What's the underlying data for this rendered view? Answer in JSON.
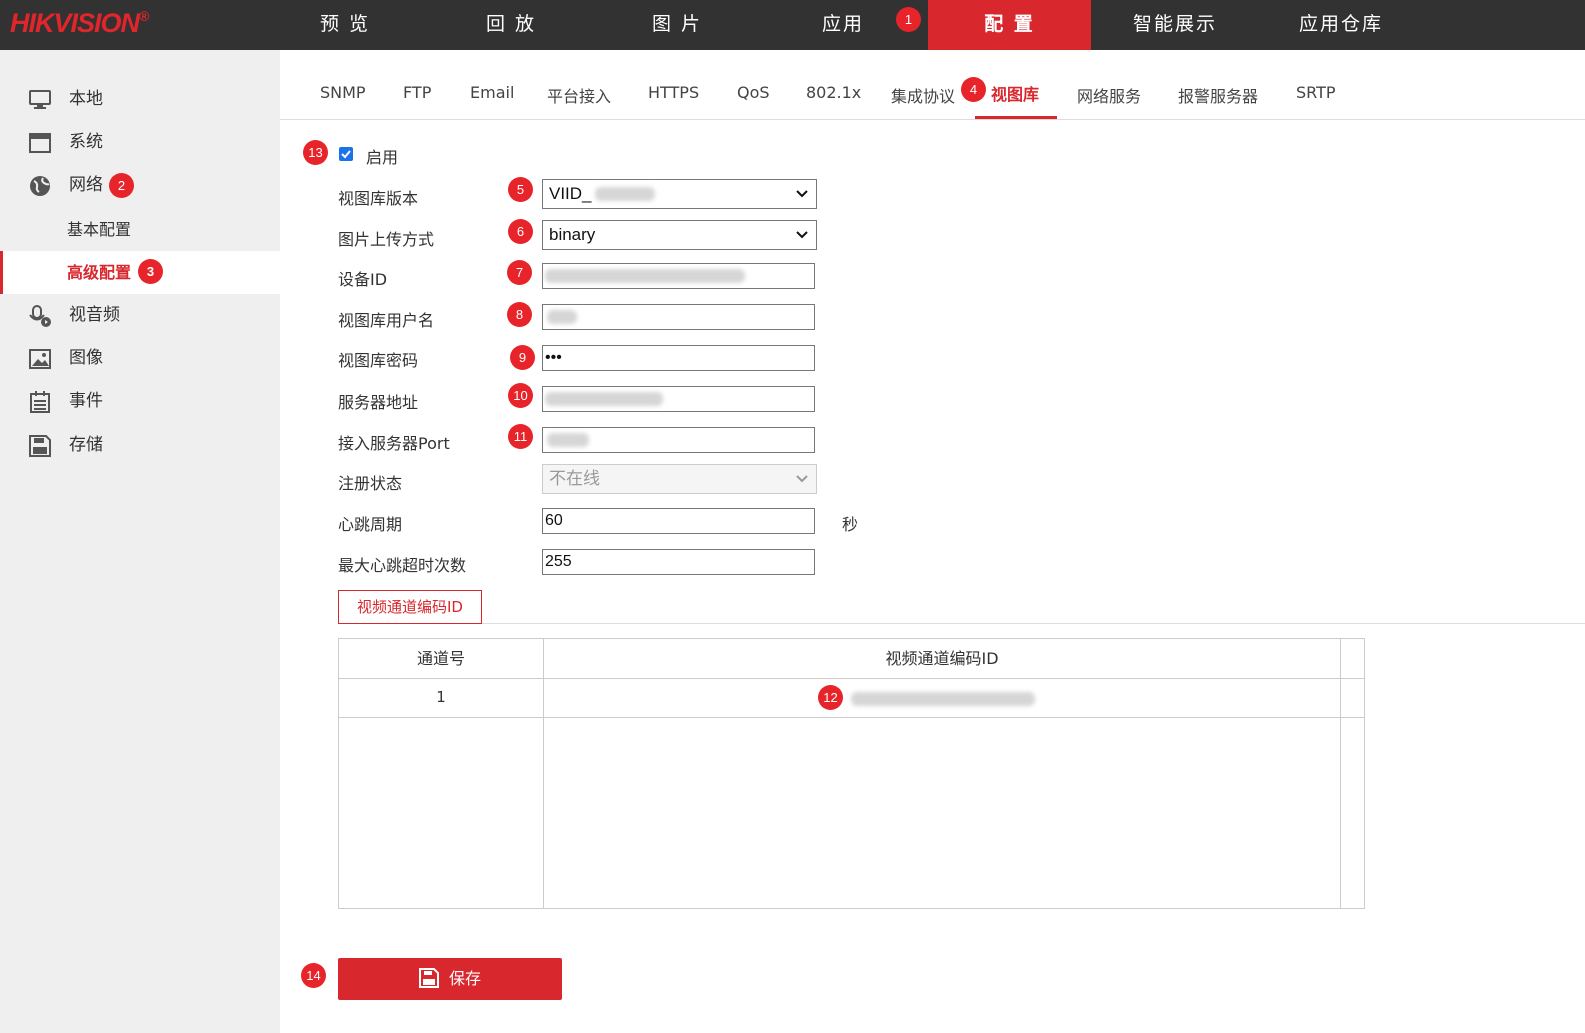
{
  "brand": {
    "name_part1": "HIK",
    "name_part2": "VISION",
    "reg": "®"
  },
  "topnav": [
    {
      "label": "预 览"
    },
    {
      "label": "回 放"
    },
    {
      "label": "图 片"
    },
    {
      "label": "应用"
    },
    {
      "label": "配 置",
      "active": true
    },
    {
      "label": "智能展示"
    },
    {
      "label": "应用仓库"
    }
  ],
  "sidebar": {
    "items": [
      {
        "label": "本地",
        "icon": "monitor-icon"
      },
      {
        "label": "系统",
        "icon": "window-icon"
      },
      {
        "label": "网络",
        "icon": "globe-icon"
      },
      {
        "label": "视音频",
        "icon": "microphone-icon"
      },
      {
        "label": "图像",
        "icon": "image-icon"
      },
      {
        "label": "事件",
        "icon": "calendar-icon"
      },
      {
        "label": "存储",
        "icon": "save-disk-icon"
      }
    ],
    "network_sub": [
      {
        "label": "基本配置"
      },
      {
        "label": "高级配置",
        "active": true
      }
    ]
  },
  "subtabs": [
    {
      "label": "SNMP"
    },
    {
      "label": "FTP"
    },
    {
      "label": "Email"
    },
    {
      "label": "平台接入"
    },
    {
      "label": "HTTPS"
    },
    {
      "label": "QoS"
    },
    {
      "label": "802.1x"
    },
    {
      "label": "集成协议"
    },
    {
      "label": "视图库",
      "active": true
    },
    {
      "label": "网络服务"
    },
    {
      "label": "报警服务器"
    },
    {
      "label": "SRTP"
    }
  ],
  "badges": [
    "1",
    "2",
    "3",
    "4",
    "5",
    "6",
    "7",
    "8",
    "9",
    "10",
    "11",
    "12",
    "13",
    "14"
  ],
  "form": {
    "enable_label": "启用",
    "enable_checked": true,
    "version_label": "视图库版本",
    "version_value": "VIID_",
    "upload_label": "图片上传方式",
    "upload_value": "binary",
    "device_id_label": "设备ID",
    "username_label": "视图库用户名",
    "password_label": "视图库密码",
    "password_value": "•••",
    "server_label": "服务器地址",
    "port_label": "接入服务器Port",
    "status_label": "注册状态",
    "status_value": "不在线",
    "heartbeat_label": "心跳周期",
    "heartbeat_value": "60",
    "heartbeat_unit": "秒",
    "max_timeout_label": "最大心跳超时次数",
    "max_timeout_value": "255"
  },
  "channel_section": {
    "button_label": "视频通道编码ID",
    "columns": [
      "通道号",
      "视频通道编码ID"
    ],
    "rows": [
      {
        "channel": "1"
      }
    ]
  },
  "save_label": "保存",
  "colors": {
    "accent": "#d9272e",
    "topbar": "#323232",
    "sidebar": "#efefef",
    "badge": "#e8242b"
  }
}
